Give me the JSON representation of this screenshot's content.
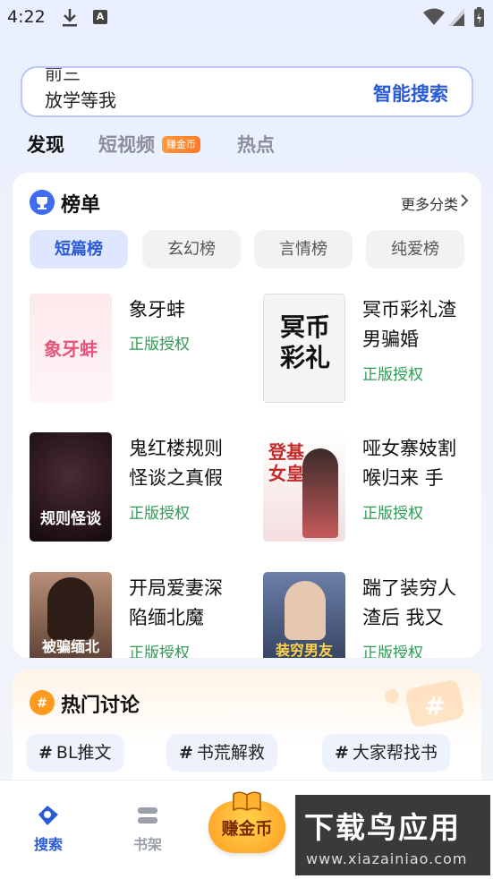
{
  "status_bar": {
    "time": "4:22",
    "a_badge": "A"
  },
  "search": {
    "peek_text": "前三",
    "query_text": "放学等我",
    "button_label": "智能搜索"
  },
  "top_tabs": {
    "discover": "发现",
    "short_video": "短视频",
    "short_video_badge": "赚金币",
    "hot": "热点"
  },
  "rank": {
    "title": "榜单",
    "more_label": "更多分类",
    "chips": [
      "短篇榜",
      "玄幻榜",
      "言情榜",
      "纯爱榜"
    ],
    "books": [
      {
        "title": "象牙蚌",
        "license": "正版授权",
        "cover_text": "象牙蚌"
      },
      {
        "title": "冥币彩礼渣男骗婚",
        "license": "正版授权",
        "cover_text": "冥币彩礼"
      },
      {
        "title": "鬼红楼规则怪谈之真假",
        "license": "正版授权",
        "cover_text": "规则怪谈"
      },
      {
        "title": "哑女寨妓割喉归来 手",
        "license": "正版授权",
        "cover_text": "登基女皇"
      },
      {
        "title": "开局爱妻深陷缅北魔",
        "license": "正版授权",
        "cover_text": "被骗缅北"
      },
      {
        "title": "踹了装穷人渣后 我又",
        "license": "正版授权",
        "cover_text": "装穷男友"
      }
    ]
  },
  "hot_discussion": {
    "title": "热门讨论",
    "topics": [
      "BL推文",
      "书荒解救",
      "大家帮找书"
    ]
  },
  "bottom_nav": {
    "search_label": "搜索",
    "shelf_label": "书架",
    "earn_label": "赚金币"
  },
  "watermark": {
    "main": "下载鸟应用",
    "sub": "www.xiazainiao.com"
  },
  "colors": {
    "accent": "#2a5bd7",
    "license_green": "#2f9b55",
    "coin_orange": "#ff8a1f"
  }
}
